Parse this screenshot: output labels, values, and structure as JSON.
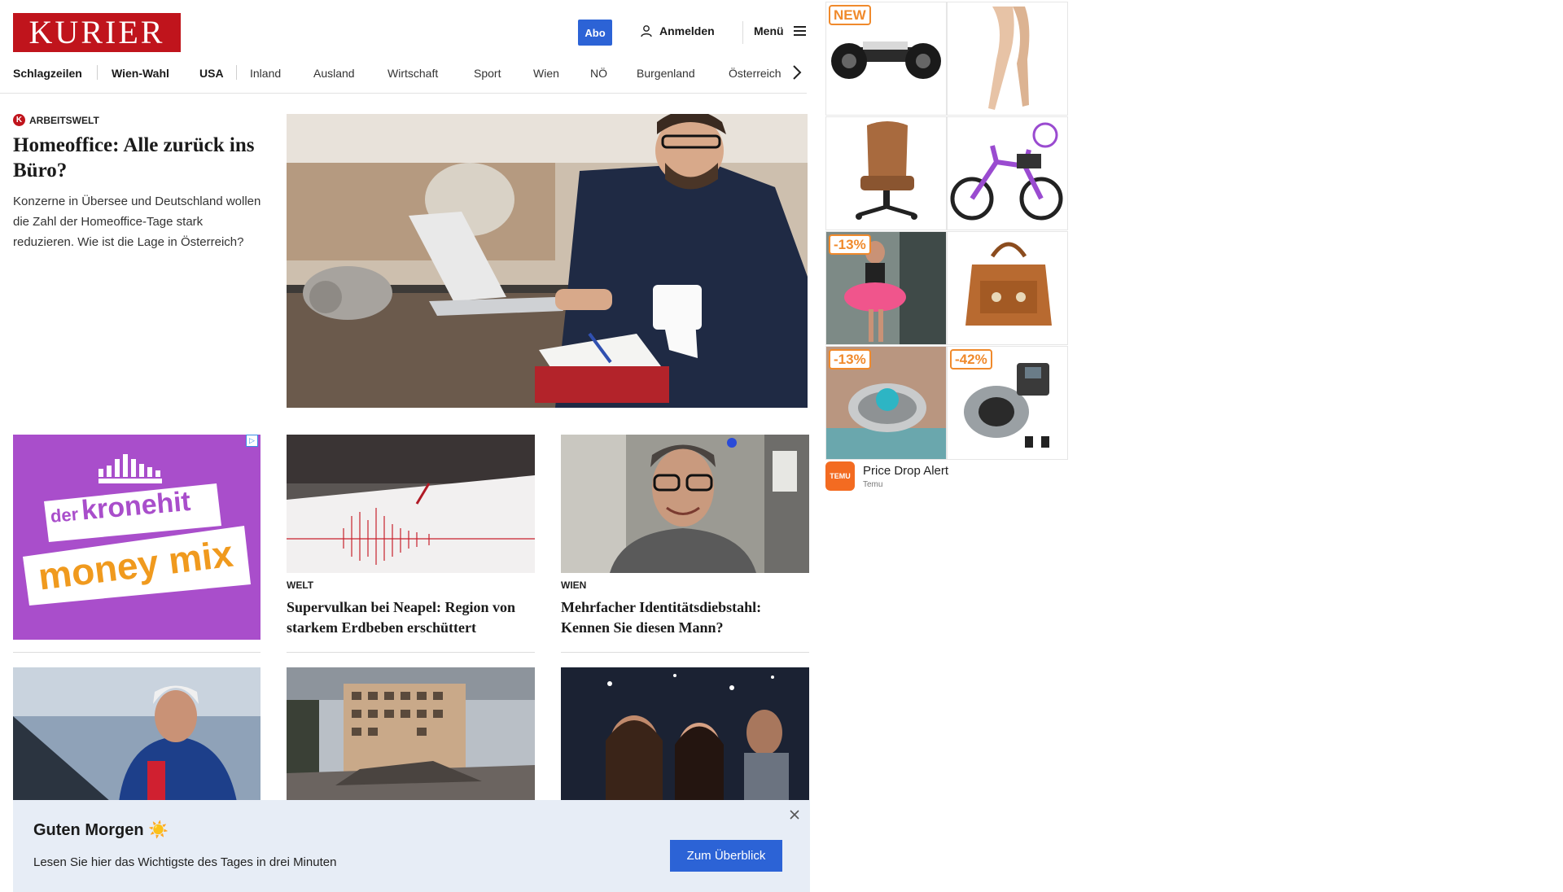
{
  "header": {
    "logo": "KURIER",
    "abo": "Abo",
    "login": "Anmelden",
    "menu": "Menü"
  },
  "nav": [
    "Schlagzeilen",
    "Wien-Wahl",
    "USA",
    "Inland",
    "Ausland",
    "Wirtschaft",
    "Sport",
    "Wien",
    "NÖ",
    "Burgenland",
    "Österreich"
  ],
  "lead": {
    "kicker": "ARBEITSWELT",
    "kicker_badge": "K",
    "title": "Homeoffice: Alle zurück ins Büro?",
    "teaser": "Konzerne in Übersee und Deutschland wollen die Zahl der Homeoffice-Tage stark reduzieren. Wie ist die Lage in Österreich?"
  },
  "cards": [
    {
      "kicker": "WELT",
      "title": "Supervulkan bei Neapel: Region von starkem Erdbeben erschüttert"
    },
    {
      "kicker": "WIEN",
      "title": "Mehrfacher Identitätsdiebstahl: Kennen Sie diesen Mann?"
    }
  ],
  "kronehit_ad": {
    "line1": "der",
    "line2": "kronehit",
    "line3": "money mix"
  },
  "temu_ad": {
    "tags": [
      "NEW",
      "-13%",
      "-13%",
      "-42%"
    ],
    "title": "Price Drop Alert",
    "source": "Temu",
    "logo_text": "TEMU"
  },
  "banner": {
    "title": "Guten Morgen ☀️",
    "text": "Lesen Sie hier das Wichtigste des Tages in drei Minuten",
    "button": "Zum Überblick"
  },
  "colors": {
    "brand": "#c0141c",
    "accent": "#2c63d6",
    "banner_bg": "#e7edf6",
    "ad_tag": "#f08a2c"
  }
}
